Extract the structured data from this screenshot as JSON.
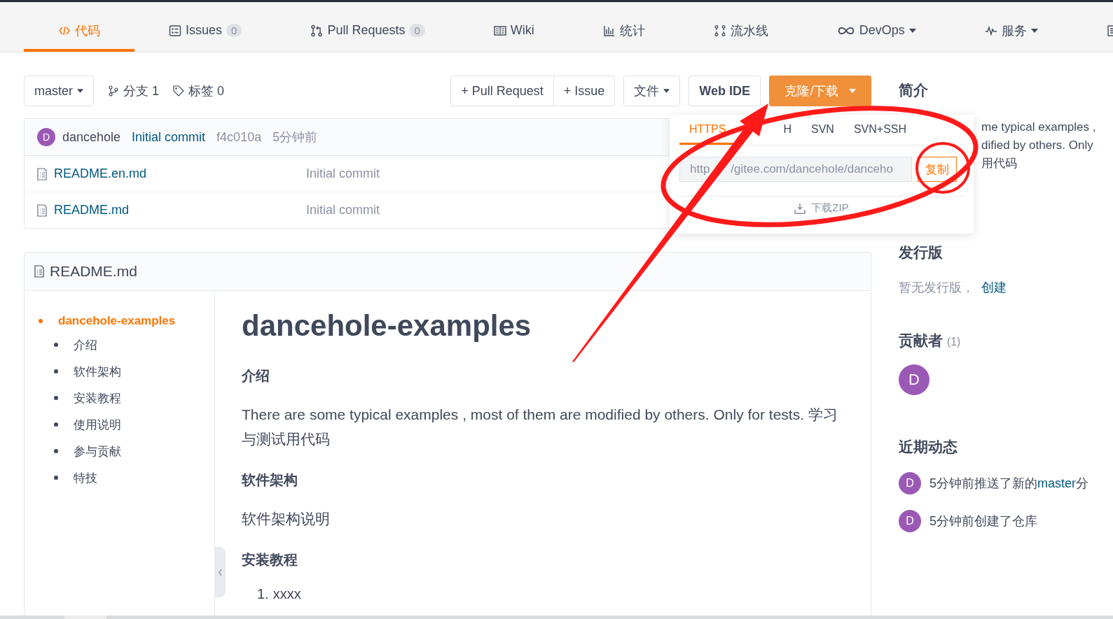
{
  "tabs": [
    {
      "kind": "code",
      "label": "代码",
      "selected": true
    },
    {
      "kind": "issues",
      "label": "Issues",
      "count": "0",
      "selected": false
    },
    {
      "kind": "pr",
      "label": "Pull Requests",
      "count": "0",
      "selected": false
    },
    {
      "kind": "book",
      "label": "Wiki",
      "selected": false
    },
    {
      "kind": "chart",
      "label": "统计",
      "selected": false
    },
    {
      "kind": "pipeline",
      "label": "流水线",
      "selected": false
    },
    {
      "kind": "infinity",
      "label": "DevOps",
      "dropdown": true,
      "selected": false
    },
    {
      "kind": "pulse",
      "label": "服务",
      "dropdown": true,
      "selected": false
    },
    {
      "kind": "doc",
      "selected": false
    }
  ],
  "toolbar": {
    "branch": "master",
    "branches": "分支 1",
    "tags": "标签 0",
    "pull_request": "+ Pull Request",
    "issue": "+ Issue",
    "file_menu": "文件",
    "web_ide": "Web IDE",
    "clone": "克隆/下载"
  },
  "clone_panel": {
    "tabs": [
      {
        "label": "HTTPS",
        "selected": true
      },
      {
        "label": "H",
        "selected": false
      },
      {
        "label": "SVN",
        "selected": false
      },
      {
        "label": "SVN+SSH",
        "selected": false
      }
    ],
    "url_parts": [
      "http",
      "/gitee.com/dancehole/danceho"
    ],
    "copy": "复制",
    "download": "下载ZIP"
  },
  "commit": {
    "avatar": "D",
    "author": "dancehole",
    "message": "Initial commit",
    "hash": "f4c010a",
    "time": "5分钟前"
  },
  "files": [
    {
      "name": "README.en.md",
      "message": "Initial commit"
    },
    {
      "name": "README.md",
      "message": "Initial commit"
    }
  ],
  "readme": {
    "title": "README.md",
    "toc": [
      {
        "label": "dancehole-examples",
        "selected": true,
        "children": [
          {
            "label": "介绍",
            "selected": false
          },
          {
            "label": "软件架构",
            "selected": false
          },
          {
            "label": "安装教程",
            "selected": false
          },
          {
            "label": "使用说明",
            "selected": false
          },
          {
            "label": "参与贡献",
            "selected": false
          },
          {
            "label": "特技",
            "selected": false
          }
        ]
      }
    ],
    "content": [
      {
        "kind": "h1",
        "text": "dancehole-examples"
      },
      {
        "kind": "h2",
        "text": "介绍"
      },
      {
        "kind": "p",
        "text": "There are some typical examples , most of them are modified by others. Only for tests. 学习与测试用代码"
      },
      {
        "kind": "h2",
        "text": "软件架构"
      },
      {
        "kind": "p",
        "text": "软件架构说明"
      },
      {
        "kind": "h2",
        "text": "安装教程"
      },
      {
        "kind": "ol",
        "items": [
          {
            "number": "1.",
            "text": "xxxx"
          }
        ]
      }
    ]
  },
  "sidebar": {
    "intro_title": "简介",
    "intro_lines": [
      "me typical examples ,",
      "dified by others. Only",
      "用代码"
    ],
    "release_title": "发行版",
    "release_text": "暂无发行版，",
    "release_link": "创建",
    "contributors_title": "贡献者",
    "contributors_count": "(1)",
    "contributors": [
      {
        "initial": "D"
      }
    ],
    "activity_title": "近期动态",
    "activity": [
      {
        "initial": "D",
        "text": "5分钟前推送了新的",
        "link": "master",
        "after": "分"
      },
      {
        "initial": "D",
        "text": "5分钟前创建了仓库"
      }
    ]
  }
}
